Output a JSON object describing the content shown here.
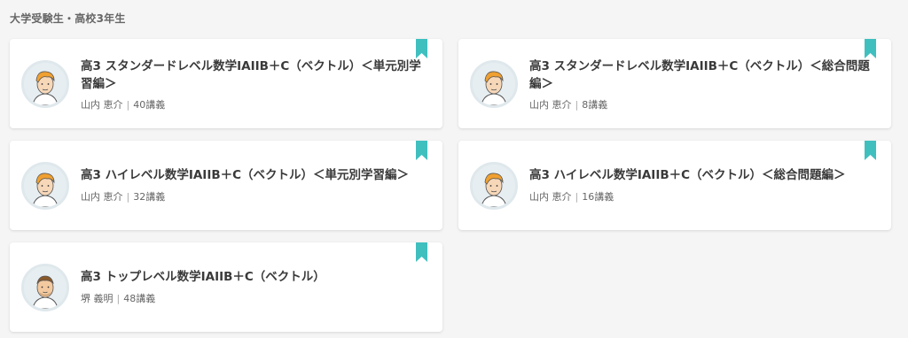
{
  "section": {
    "title": "大学受験生・高校3年生"
  },
  "colors": {
    "bookmark": "#40bfbf",
    "background": "#f5f5f5"
  },
  "cards": [
    {
      "title": "高3 スタンダードレベル数学IAIIB＋C（ベクトル）＜単元別学習編＞",
      "teacher": "山内 恵介",
      "lectures": "40講義",
      "avatar": "teacher-yamauchi"
    },
    {
      "title": "高3 スタンダードレベル数学IAIIB＋C（ベクトル）＜総合問題編＞",
      "teacher": "山内 恵介",
      "lectures": "8講義",
      "avatar": "teacher-yamauchi"
    },
    {
      "title": "高3 ハイレベル数学IAIIB＋C（ベクトル）＜単元別学習編＞",
      "teacher": "山内 恵介",
      "lectures": "32講義",
      "avatar": "teacher-yamauchi"
    },
    {
      "title": "高3 ハイレベル数学IAIIB＋C（ベクトル）＜総合問題編＞",
      "teacher": "山内 恵介",
      "lectures": "16講義",
      "avatar": "teacher-yamauchi"
    },
    {
      "title": "高3 トップレベル数学IAIIB＋C（ベクトル）",
      "teacher": "堺 義明",
      "lectures": "48講義",
      "avatar": "teacher-sakai"
    }
  ],
  "meta_separator": "|"
}
